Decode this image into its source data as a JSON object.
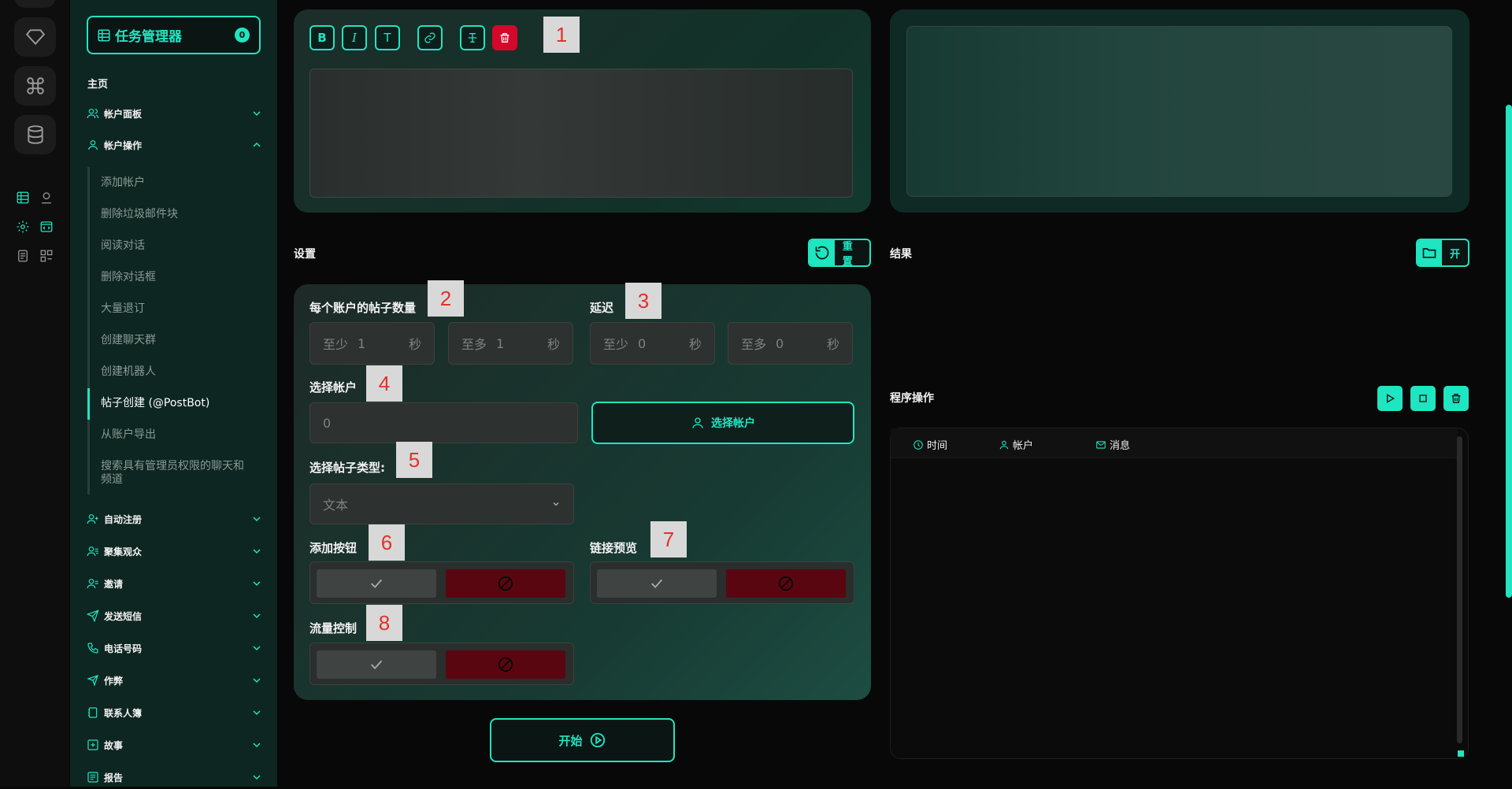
{
  "sidebar": {
    "brand_title": "任务管理器",
    "brand_badge": "0",
    "section_label": "主页",
    "groups": [
      {
        "label": "帐户面板",
        "icon": "users-icon"
      },
      {
        "label": "帐户操作",
        "icon": "user-icon"
      }
    ],
    "sub_items": [
      "添加帐户",
      "删除垃圾邮件块",
      "阅读对话",
      "删除对话框",
      "大量退订",
      "创建聊天群",
      "创建机器人",
      "帖子创建 (@PostBot)",
      "从账户导出",
      "搜索具有管理员权限的聊天和频道"
    ],
    "active_sub_index": 7,
    "more_groups": [
      {
        "label": "自动注册",
        "icon": "user-plus-icon"
      },
      {
        "label": "聚集观众",
        "icon": "user-list-icon"
      },
      {
        "label": "邀请",
        "icon": "user-invite-icon"
      },
      {
        "label": "发送短信",
        "icon": "send-icon"
      },
      {
        "label": "电话号码",
        "icon": "phone-icon"
      },
      {
        "label": "作弊",
        "icon": "rocket-icon"
      },
      {
        "label": "联系人簿",
        "icon": "contacts-icon"
      },
      {
        "label": "故事",
        "icon": "plus-square-icon"
      },
      {
        "label": "报告",
        "icon": "report-icon"
      }
    ]
  },
  "editor": {
    "toolbar": [
      "B",
      "I",
      "T"
    ],
    "markers": [
      "1",
      "2",
      "3",
      "4",
      "5",
      "6",
      "7",
      "8"
    ]
  },
  "settings": {
    "title": "设置",
    "reset_label": "重置",
    "posts_per_account_label": "每个账户的帖子数量",
    "delay_label": "延迟",
    "min_prefix": "至少",
    "max_prefix": "至多",
    "seconds": "秒",
    "posts_min": "1",
    "posts_max": "1",
    "delay_min": "0",
    "delay_max": "0",
    "select_account_label": "选择帐户",
    "account_value": "0",
    "select_account_button": "选择帐户",
    "post_type_label": "选择帖子类型:",
    "post_type_value": "文本",
    "add_buttons_label": "添加按钮",
    "link_preview_label": "链接预览",
    "traffic_control_label": "流量控制"
  },
  "results": {
    "title": "结果",
    "open_label": "开"
  },
  "program": {
    "title": "程序操作",
    "columns": [
      "时间",
      "帐户",
      "消息"
    ]
  },
  "start_label": "开始",
  "colors": {
    "accent": "#1fe5c1",
    "danger": "#d4082a",
    "sidebar_bg": "#0e2621"
  }
}
